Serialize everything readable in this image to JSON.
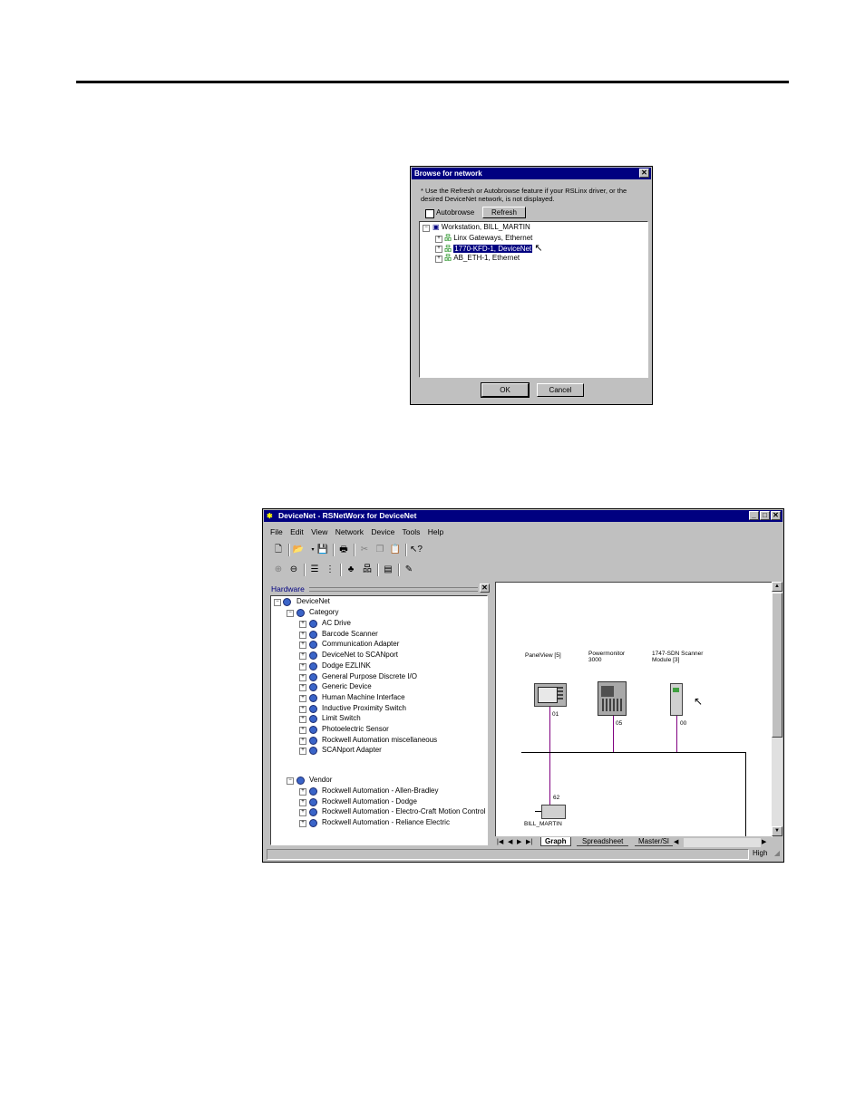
{
  "browse_dialog": {
    "title": "Browse for network",
    "note": "* Use the Refresh or Autobrowse feature if your RSLinx driver, or the desired DeviceNet network, is not displayed.",
    "autobrowse_label": "Autobrowse",
    "refresh_label": "Refresh",
    "ok_label": "OK",
    "cancel_label": "Cancel",
    "tree": {
      "root": "Workstation, BILL_MARTIN",
      "children": [
        "Linx Gateways, Ethernet",
        "1770-KFD-1, DeviceNet",
        "AB_ETH-1, Ethernet"
      ]
    }
  },
  "main_window": {
    "title": "DeviceNet - RSNetWorx for DeviceNet",
    "menu": [
      "File",
      "Edit",
      "View",
      "Network",
      "Device",
      "Tools",
      "Help"
    ],
    "hardware_label": "Hardware",
    "tree": {
      "root": "DeviceNet",
      "category_label": "Category",
      "categories": [
        "AC Drive",
        "Barcode Scanner",
        "Communication Adapter",
        "DeviceNet to SCANport",
        "Dodge EZLINK",
        "General Purpose Discrete I/O",
        "Generic Device",
        "Human Machine Interface",
        "Inductive Proximity Switch",
        "Limit Switch",
        "Photoelectric Sensor",
        "Rockwell Automation miscellaneous",
        "SCANport Adapter"
      ],
      "vendor_label": "Vendor",
      "vendors": [
        "Rockwell Automation - Allen-Bradley",
        "Rockwell Automation - Dodge",
        "Rockwell Automation - Electro-Craft Motion Control",
        "Rockwell Automation - Reliance Electric"
      ]
    },
    "graph": {
      "devices": [
        {
          "label": "PanelView [5]",
          "addr": "01"
        },
        {
          "label": "Powermonitor 3000",
          "addr": "05"
        },
        {
          "label": "1747-SDN Scanner Module [3]",
          "addr": "00"
        },
        {
          "label": "BILL_MARTIN",
          "addr": "62"
        }
      ]
    },
    "tabs": [
      "Graph",
      "Spreadsheet",
      "Master/Sl"
    ],
    "status": "High"
  }
}
